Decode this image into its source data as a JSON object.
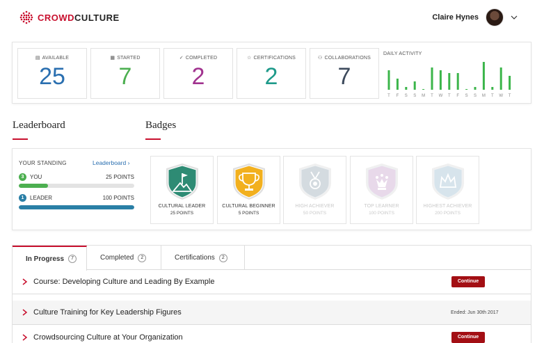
{
  "brand": {
    "name_a": "CROWD",
    "name_b": "CULTURE",
    "accent": "#c8102e"
  },
  "user": {
    "name": "Claire Hynes"
  },
  "stats": [
    {
      "key": "available",
      "label": "AVAILABLE",
      "icon": "book-icon",
      "value": "25",
      "color": "#2a6fb0"
    },
    {
      "key": "started",
      "label": "STARTED",
      "icon": "calendar-icon",
      "value": "7",
      "color": "#4caf50"
    },
    {
      "key": "completed",
      "label": "COMPLETED",
      "icon": "check-icon",
      "value": "2",
      "color": "#a1338f"
    },
    {
      "key": "certifications",
      "label": "CERTIFICATIONS",
      "icon": "star-icon",
      "value": "2",
      "color": "#1e9a8a"
    },
    {
      "key": "collaborations",
      "label": "COLLABORATIONS",
      "icon": "people-icon",
      "value": "7",
      "color": "#3d4a5c"
    }
  ],
  "activity": {
    "label": "DAILY ACTIVITY",
    "days": [
      "T",
      "F",
      "S",
      "S",
      "M",
      "T",
      "W",
      "T",
      "F",
      "S",
      "S",
      "M",
      "T",
      "W",
      "T"
    ],
    "values": [
      7,
      4,
      1,
      3,
      0,
      8,
      7,
      6,
      6,
      0,
      1,
      10,
      1,
      8,
      5
    ],
    "color": "#3bb54a"
  },
  "leaderboard": {
    "section_title": "Leaderboard",
    "standing_title": "YOUR STANDING",
    "link_label": "Leaderboard",
    "rows": [
      {
        "rank": "3",
        "name": "YOU",
        "points": "25 POINTS",
        "progress": 0.25,
        "color": "#4caf50"
      },
      {
        "rank": "1",
        "name": "LEADER",
        "points": "100 POINTS",
        "progress": 1.0,
        "color": "#2a7fa6"
      }
    ]
  },
  "badges": {
    "section_title": "Badges",
    "items": [
      {
        "name": "CULTURAL LEADER",
        "points": "25 POINTS",
        "earned": true,
        "icon": "flag-mountain-icon",
        "color": "#2e8b74"
      },
      {
        "name": "CULTURAL BEGINNER",
        "points": "5 POINTS",
        "earned": true,
        "icon": "trophy-icon",
        "color": "#f2b01e"
      },
      {
        "name": "HIGH ACHIEVER",
        "points": "50 POINTS",
        "earned": false,
        "icon": "medal-icon",
        "color": "#d4dbe0"
      },
      {
        "name": "TOP LEARNER",
        "points": "100 POINTS",
        "earned": false,
        "icon": "chess-king-icon",
        "color": "#e8d9ea"
      },
      {
        "name": "HIGHEST ACHIEVER",
        "points": "200 POINTS",
        "earned": false,
        "icon": "crown-icon",
        "color": "#d7e4ec"
      }
    ]
  },
  "tabs": [
    {
      "label": "In Progress",
      "count": "7",
      "active": true
    },
    {
      "label": "Completed",
      "count": "2",
      "active": false
    },
    {
      "label": "Certifications",
      "count": "2",
      "active": false
    }
  ],
  "courses": [
    {
      "title": "Course: Developing Culture and Leading By Example",
      "action": "Continue",
      "ended": ""
    },
    {
      "title": "Culture Training for Key Leadership Figures",
      "action": "",
      "ended": "Ended: Jun 30th 2017"
    },
    {
      "title": "Crowdsourcing Culture at Your Organization",
      "action": "Continue",
      "ended": ""
    }
  ]
}
